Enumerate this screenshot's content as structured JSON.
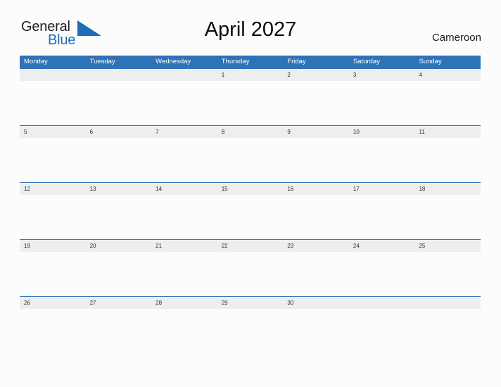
{
  "brand": {
    "name_dark": "General",
    "name_blue": "Blue",
    "flag_icon": "triangle-flag-icon",
    "dark_color": "#231f20",
    "blue_color": "#1f6db5"
  },
  "header": {
    "title": "April 2027",
    "country": "Cameroon"
  },
  "calendar": {
    "header_bg": "#2e72b8",
    "row_band_bg": "#eeeeee",
    "weekdays": [
      "Monday",
      "Tuesday",
      "Wednesday",
      "Thursday",
      "Friday",
      "Saturday",
      "Sunday"
    ],
    "weeks": [
      [
        "",
        "",
        "",
        "1",
        "2",
        "3",
        "4"
      ],
      [
        "5",
        "6",
        "7",
        "8",
        "9",
        "10",
        "11"
      ],
      [
        "12",
        "13",
        "14",
        "15",
        "16",
        "17",
        "18"
      ],
      [
        "19",
        "20",
        "21",
        "22",
        "23",
        "24",
        "25"
      ],
      [
        "26",
        "27",
        "28",
        "29",
        "30",
        "",
        ""
      ]
    ]
  }
}
